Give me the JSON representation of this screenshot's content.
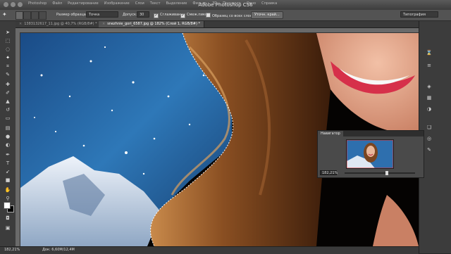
{
  "app": {
    "title": "Adobe Photoshop CS6"
  },
  "menu": [
    "Photoshop",
    "Файл",
    "Редактирование",
    "Изображение",
    "Слои",
    "Текст",
    "Выделение",
    "Фильтр",
    "3D",
    "Просмотр",
    "Окно",
    "Справка"
  ],
  "options": {
    "sample_size_label": "Размер образца:",
    "sample_size_value": "Точка",
    "tolerance_label": "Допуск:",
    "tolerance_value": "30",
    "antialias_label": "Сглаживание",
    "contiguous_label": "Смеж.пикс",
    "all_layers_label": "Образец со всех слоев",
    "refine_edge_label": "Уточн. край...",
    "workspace_value": "Типография"
  },
  "tabs": [
    {
      "label": "1383132617_11.jpg @ 40,7% (RGB/8#) *"
    },
    {
      "label": "snezhnie_gori_6587.jpg @ 182% (Слой 1, RGB/8#) *"
    }
  ],
  "navigator": {
    "title": "Навигатор",
    "zoom": "182,21%"
  },
  "status": {
    "zoom": "182,21%",
    "doc": "Док: 6,60M/12,4M"
  },
  "colors": {
    "accent": "#4a90d9",
    "panel": "#535353",
    "dark": "#282828"
  },
  "icons": {
    "tools": [
      "move-icon",
      "marquee-icon",
      "lasso-icon",
      "magic-wand-icon",
      "crop-icon",
      "eyedropper-icon",
      "healing-icon",
      "brush-icon",
      "stamp-icon",
      "history-brush-icon",
      "eraser-icon",
      "gradient-icon",
      "blur-icon",
      "dodge-icon",
      "pen-icon",
      "type-icon",
      "path-select-icon",
      "shape-icon",
      "hand-icon",
      "zoom-icon"
    ]
  }
}
